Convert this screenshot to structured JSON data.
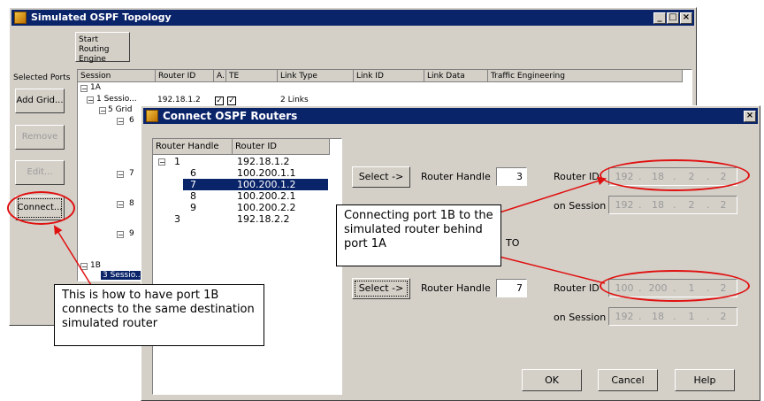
{
  "back_window": {
    "title": "Simulated OSPF Topology",
    "start_button": "Start Routing Engine",
    "selected_ports_label": "Selected Ports",
    "side_buttons": [
      "Add Grid...",
      "Remove",
      "Edit...",
      "Connect..."
    ],
    "columns": [
      "Session",
      "Router ID",
      "A.",
      "TE",
      "Link Type",
      "Link ID",
      "Link Data",
      "Traffic Engineering"
    ],
    "tree": {
      "port_1a": "1A",
      "session_1": "1 Sessio...",
      "session_1_router_id": "192.18.1.2",
      "session_1_links": "2 Links",
      "grid_5": "5 Grid",
      "n6": "6",
      "n7": "7",
      "n8": "8",
      "n9": "9",
      "port_1b": "1B",
      "session_3": "3 Sessio..."
    }
  },
  "dialog": {
    "title": "Connect OSPF Routers",
    "list_headers": [
      "Router Handle",
      "Router ID"
    ],
    "list_rows": [
      {
        "handle": "1",
        "router_id": "192.18.1.2"
      },
      {
        "handle": "6",
        "router_id": "100.200.1.1"
      },
      {
        "handle": "7",
        "router_id": "100.200.1.2"
      },
      {
        "handle": "8",
        "router_id": "100.200.2.1"
      },
      {
        "handle": "9",
        "router_id": "100.200.2.2"
      },
      {
        "handle": "3",
        "router_id": "192.18.2.2"
      }
    ],
    "select_label": "Select ->",
    "router_handle_label": "Router Handle",
    "router_id_label": "Router ID",
    "on_session_label": "on Session",
    "to_label": "TO",
    "top": {
      "router_handle": "3",
      "router_id": [
        "192",
        "18",
        "2",
        "2"
      ],
      "on_session": [
        "192",
        "18",
        "2",
        "2"
      ]
    },
    "bottom": {
      "router_handle": "7",
      "router_id": [
        "100",
        "200",
        "1",
        "2"
      ],
      "on_session": [
        "192",
        "18",
        "1",
        "2"
      ]
    },
    "ok": "OK",
    "cancel": "Cancel",
    "help": "Help"
  },
  "annotations": {
    "callout_connecting": "Connecting port 1B to the simulated router behind port 1A",
    "callout_how_to": "This is how to have port 1B connects to the same destination simulated router",
    "accent_color": "#e01010"
  }
}
